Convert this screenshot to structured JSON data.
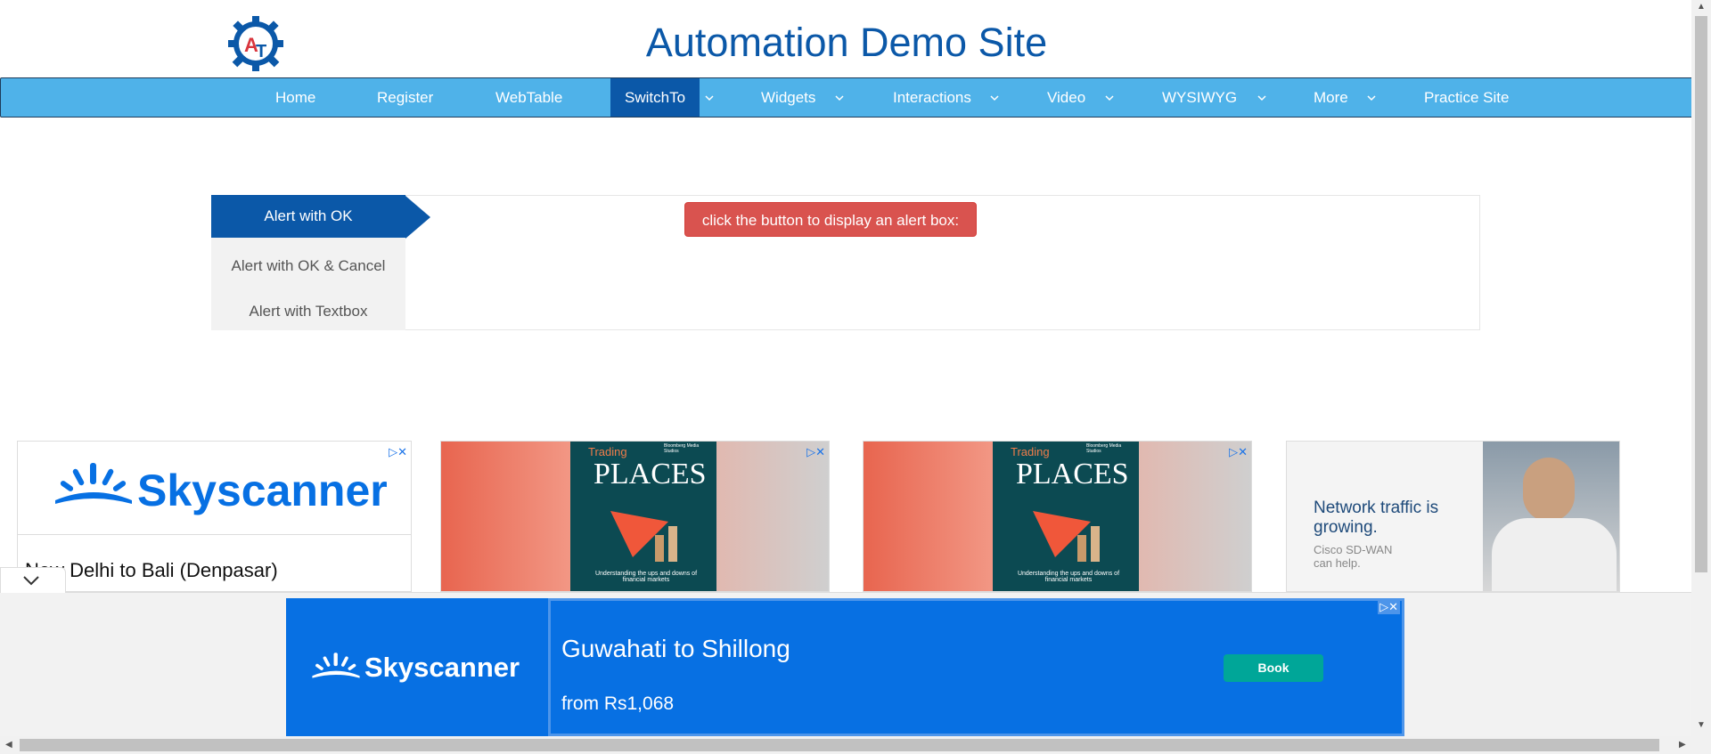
{
  "header": {
    "title": "Automation Demo Site",
    "logo_letters": "AT",
    "accent": "#0b58a8"
  },
  "nav": {
    "items": [
      {
        "label": "Home"
      },
      {
        "label": "Register"
      },
      {
        "label": "WebTable"
      },
      {
        "label": "SwitchTo",
        "active": true
      },
      {
        "label": "Widgets"
      },
      {
        "label": "Interactions"
      },
      {
        "label": "Video"
      },
      {
        "label": "WYSIWYG"
      },
      {
        "label": "More"
      },
      {
        "label": "Practice Site"
      }
    ]
  },
  "alerts": {
    "tabs": [
      {
        "label": "Alert with OK",
        "active": true
      },
      {
        "label": "Alert with OK & Cancel"
      },
      {
        "label": "Alert with Textbox"
      }
    ],
    "button_label": "click the button to display an alert box:"
  },
  "ads": {
    "skyscanner_brand": "Skyscanner",
    "skyscanner_route": "New Delhi to Bali (Denpasar)",
    "trading_title_small": "Trading",
    "trading_title_big": "PLACES",
    "trading_sub": "Understanding the ups and downs of financial markets",
    "trading_publisher": "Bloomberg Media Studios",
    "cisco_headline": "Network traffic is growing.",
    "cisco_sub": "Cisco SD-WAN can help.",
    "bottom_route": "Guwahati to Shillong",
    "bottom_price": "from Rs1,068",
    "bottom_book": "Book"
  }
}
